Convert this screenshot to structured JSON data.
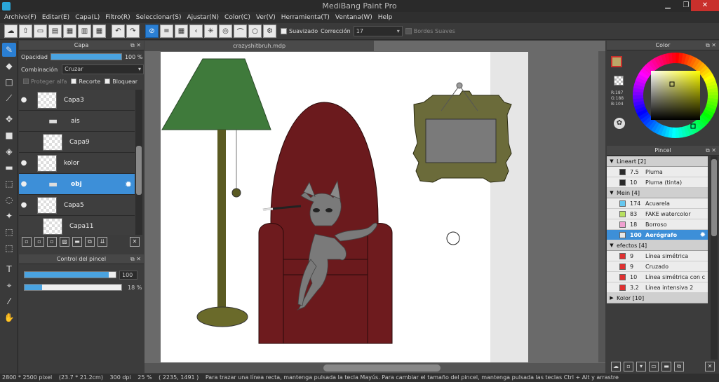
{
  "window": {
    "title": "MediBang Paint Pro",
    "minimize": "▁",
    "maximize": "❐",
    "close": "✕"
  },
  "menu": [
    "Archivo(F)",
    "Editar(E)",
    "Capa(L)",
    "Filtro(R)",
    "Seleccionar(S)",
    "Ajustar(N)",
    "Color(C)",
    "Ver(V)",
    "Herramienta(T)",
    "Ventana(W)",
    "Help"
  ],
  "toolbar": {
    "suavizado_label": "Suavizado",
    "correccion_label": "Corrección",
    "correccion_value": "17",
    "bordes_label": "Bordes Suaves"
  },
  "layer_panel": {
    "title": "Capa",
    "opacity_label": "Opacidad",
    "opacity_value": "100 %",
    "opacity_fraction": 1.0,
    "blend_label": "Combinación",
    "blend_value": "Cruzar",
    "protect_alpha": "Proteger alfa",
    "clip": "Recorte",
    "lock": "Bloquear",
    "layers": [
      {
        "name": "Capa3",
        "type": "layer",
        "visible": true,
        "indent": 0
      },
      {
        "name": "ais",
        "type": "folder",
        "visible": false,
        "indent": 0
      },
      {
        "name": "Capa9",
        "type": "layer",
        "visible": false,
        "indent": 1
      },
      {
        "name": "kolor",
        "type": "layer",
        "visible": true,
        "indent": 0
      },
      {
        "name": "obj",
        "type": "folder",
        "visible": true,
        "indent": 0,
        "selected": true
      },
      {
        "name": "Capa5",
        "type": "layer",
        "visible": true,
        "indent": 0
      },
      {
        "name": "Capa11",
        "type": "layer",
        "visible": false,
        "indent": 1
      }
    ]
  },
  "brush_control": {
    "title": "Control del pincel",
    "size_value": "100",
    "size_fraction": 0.92,
    "opacity_value": "18 %",
    "opacity_fraction": 0.18
  },
  "document": {
    "tab": "crazyshitbruh.mdp"
  },
  "color_panel": {
    "title": "Color",
    "primary": "#bba868",
    "r": "R:187",
    "g": "G:188",
    "b": "B:104"
  },
  "brush_panel": {
    "title": "Pincel",
    "groups": [
      {
        "name": "Lineart [2]",
        "expanded": true,
        "items": [
          {
            "size": "7.5",
            "name": "Pluma",
            "color": "#2a2a2a"
          },
          {
            "size": "10",
            "name": "Pluma (tinta)",
            "color": "#2a2a2a"
          }
        ]
      },
      {
        "name": "Mein [4]",
        "expanded": true,
        "items": [
          {
            "size": "174",
            "name": "Acuarela",
            "color": "#66c8f0"
          },
          {
            "size": "83",
            "name": "FAKE watercolor",
            "color": "#b8e060"
          },
          {
            "size": "18",
            "name": "Borroso",
            "color": "#f0a0d0"
          },
          {
            "size": "100",
            "name": "Aerógrafo",
            "color": "#e8e8e8",
            "selected": true
          }
        ]
      },
      {
        "name": "efectos [4]",
        "expanded": true,
        "items": [
          {
            "size": "9",
            "name": "Línea simétrica",
            "color": "#e03030"
          },
          {
            "size": "9",
            "name": "Cruzado",
            "color": "#e03030"
          },
          {
            "size": "10",
            "name": "Línea simétrica con c",
            "color": "#e03030"
          },
          {
            "size": "3.2",
            "name": "Línea intensiva 2",
            "color": "#e03030"
          }
        ]
      },
      {
        "name": "Kolor [10]",
        "expanded": false,
        "items": []
      }
    ]
  },
  "status": {
    "size": "2800 * 2500 pixel",
    "cm": "(23.7 * 21.2cm)",
    "dpi": "300 dpi",
    "zoom": "25 %",
    "coords": "( 2235, 1491 )",
    "hint": "Para trazar una línea recta, mantenga pulsada la tecla Mayús. Para cambiar el tamaño del pincel, mantenga pulsada las teclas Ctrl + Alt y arrastre"
  }
}
